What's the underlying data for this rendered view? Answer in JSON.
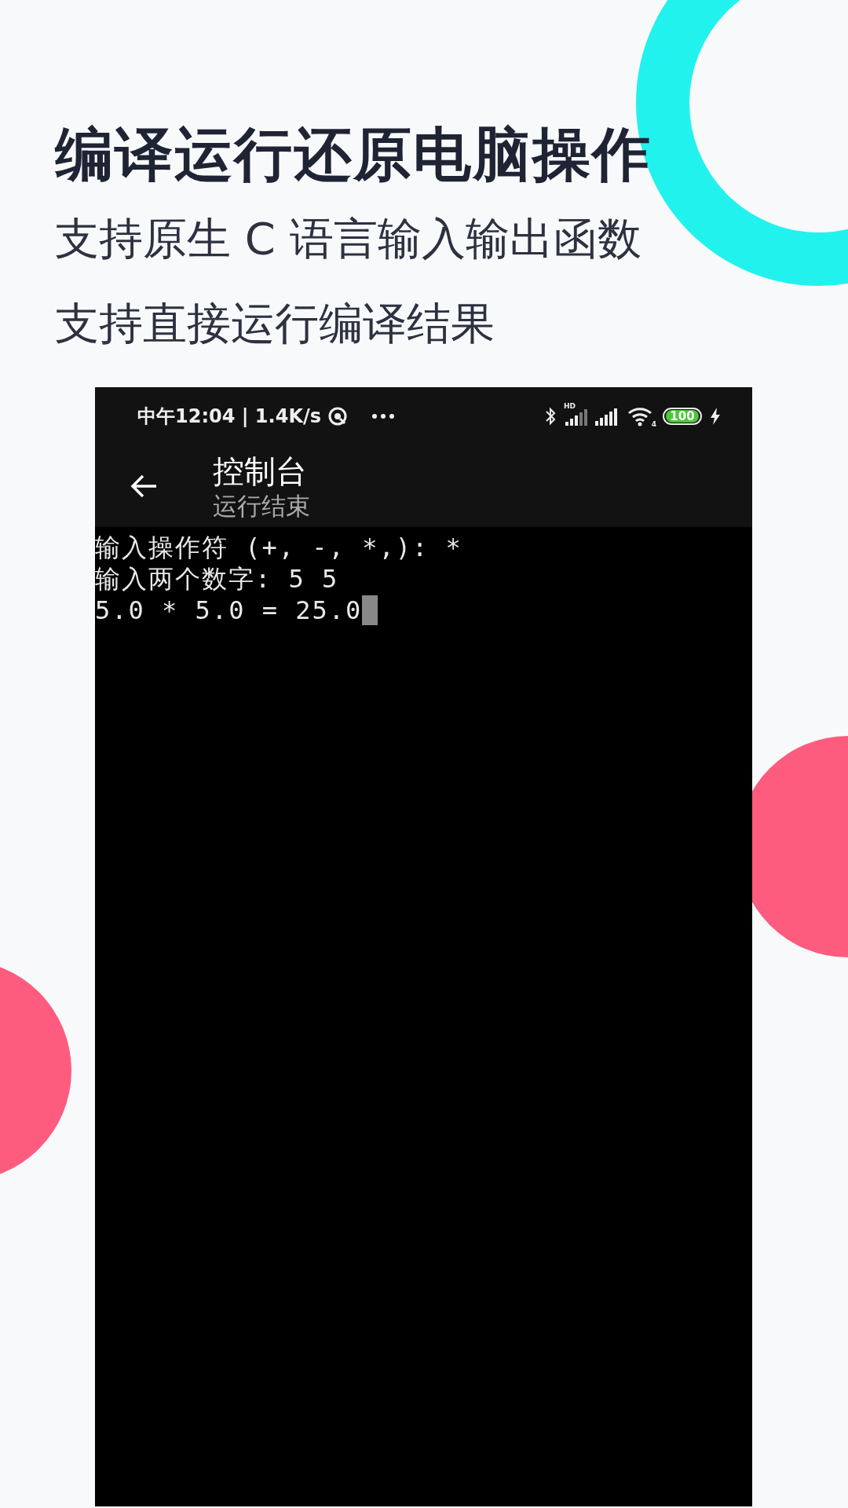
{
  "headline": "编译运行还原电脑操作",
  "subtitles": [
    "支持原生 C 语言输入输出函数",
    "支持直接运行编译结果"
  ],
  "phone": {
    "status_bar": {
      "time_speed": "中午12:04 | 1.4K/s",
      "network_label": "HD",
      "wifi_label": "4",
      "battery": "100"
    },
    "app_bar": {
      "title": "控制台",
      "subtitle": "运行结束"
    },
    "console": {
      "lines": [
        "输入操作符 (+, -, *,): *",
        "输入两个数字: 5 5",
        "5.0 * 5.0 = 25.0"
      ]
    }
  }
}
